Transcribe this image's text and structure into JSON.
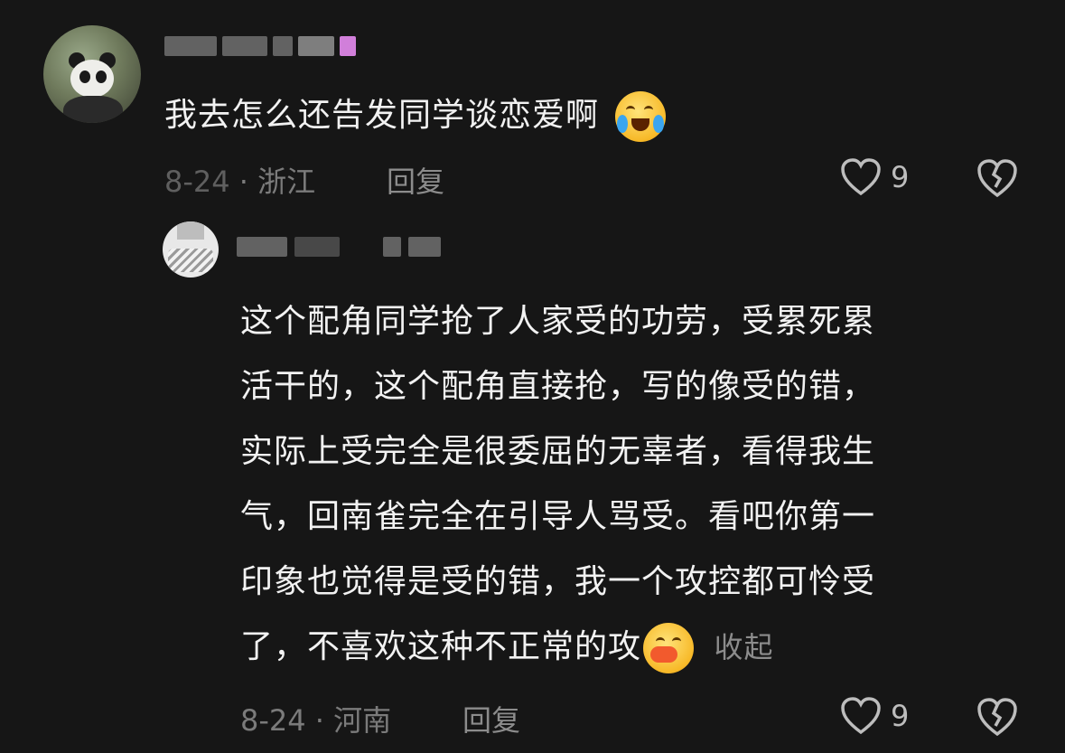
{
  "comments": [
    {
      "username": "",
      "text": "我去怎么还告发同学谈恋爱啊",
      "emoji": "crying-laughing-emoji",
      "date": "8-24",
      "location": "· 浙江",
      "reply_label": "回复",
      "likes": "9"
    },
    {
      "username": "",
      "lines": [
        "这个配角同学抢了人家受的功劳，受累死累",
        "活干的，这个配角直接抢，写的像受的错，",
        "实际上受完全是很委屈的无辜者，看得我生",
        "气，回南雀完全在引导人骂受。看吧你第一",
        "印象也觉得是受的错，我一个攻控都可怜受",
        "了，不喜欢这种不正常的攻"
      ],
      "emoji": "kissing-lips-emoji",
      "collapse_label": "收起",
      "date": "8-24",
      "location": "· 河南",
      "reply_label": "回复",
      "likes": "9"
    }
  ],
  "colors": {
    "background": "#161616",
    "text": "#f2f2f2",
    "meta": "#7b7b7b"
  }
}
